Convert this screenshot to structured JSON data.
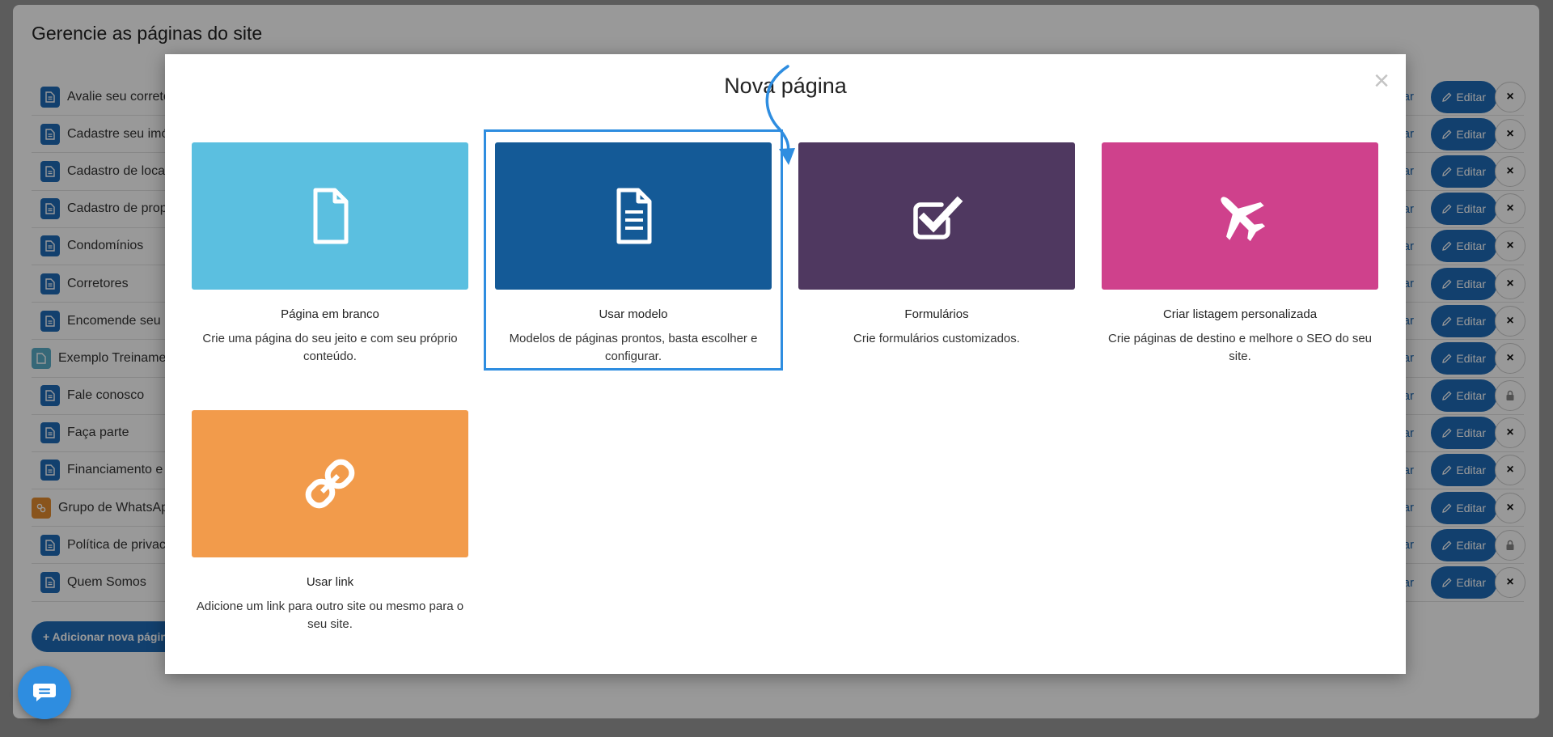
{
  "page": {
    "title": "Gerencie as páginas do site",
    "add_button": "+ Adicionar nova página",
    "rows": [
      {
        "label": "Avalie seu corretor",
        "link": "ar",
        "edit": "Editar",
        "action": "×",
        "icon": "document-icon"
      },
      {
        "label": "Cadastre seu imóvel",
        "link": "ar",
        "edit": "Editar",
        "action": "×",
        "icon": "document-icon"
      },
      {
        "label": "Cadastro de locatário",
        "link": "ar",
        "edit": "Editar",
        "action": "×",
        "icon": "document-icon"
      },
      {
        "label": "Cadastro de proposta",
        "link": "ar",
        "edit": "Editar",
        "action": "×",
        "icon": "document-icon"
      },
      {
        "label": "Condomínios",
        "link": "ar",
        "edit": "Editar",
        "action": "×",
        "icon": "document-icon"
      },
      {
        "label": "Corretores",
        "link": "ar",
        "edit": "Editar",
        "action": "×",
        "icon": "document-icon"
      },
      {
        "label": "Encomende seu imóvel",
        "link": "ar",
        "edit": "Editar",
        "action": "×",
        "icon": "document-icon"
      },
      {
        "label": "Exemplo Treinamento",
        "link": "ar",
        "edit": "Editar",
        "action": "×",
        "icon": "blank-document-icon"
      },
      {
        "label": "Fale conosco",
        "link": "ar",
        "edit": "Editar",
        "action": "lock",
        "icon": "document-icon"
      },
      {
        "label": "Faça parte",
        "link": "ar",
        "edit": "Editar",
        "action": "×",
        "icon": "document-icon"
      },
      {
        "label": "Financiamento e b",
        "link": "ar",
        "edit": "Editar",
        "action": "×",
        "icon": "document-icon"
      },
      {
        "label": "Grupo de WhatsApp",
        "link": "ar",
        "edit": "Editar",
        "action": "×",
        "icon": "link-icon"
      },
      {
        "label": "Política de privacidade",
        "link": "ar",
        "edit": "Editar",
        "action": "lock",
        "icon": "document-icon"
      },
      {
        "label": "Quem Somos",
        "link": "ar",
        "edit": "Editar",
        "action": "×",
        "icon": "document-icon"
      }
    ]
  },
  "modal": {
    "title": "Nova página",
    "close": "×",
    "options": [
      {
        "title": "Página em branco",
        "description": "Crie uma página do seu jeito e com seu próprio conteúdo.",
        "color": "#5bbfe0",
        "icon": "blank-file-icon"
      },
      {
        "title": "Usar modelo",
        "description": "Modelos de páginas prontos, basta escolher e configurar.",
        "color": "#145a97",
        "icon": "file-text-icon"
      },
      {
        "title": "Formulários",
        "description": "Crie formulários customizados.",
        "color": "#4f3860",
        "icon": "checkbox-icon"
      },
      {
        "title": "Criar listagem personalizada",
        "description": "Crie páginas de destino e melhore o SEO do seu site.",
        "color": "#cf418c",
        "icon": "airplane-icon"
      },
      {
        "title": "Usar link",
        "description": "Adicione um link para outro site ou mesmo para o seu site.",
        "color": "#f29b4b",
        "icon": "chain-link-icon"
      }
    ]
  },
  "colors": {
    "accent": "#1e6bb8",
    "highlight": "#2e8de0"
  }
}
